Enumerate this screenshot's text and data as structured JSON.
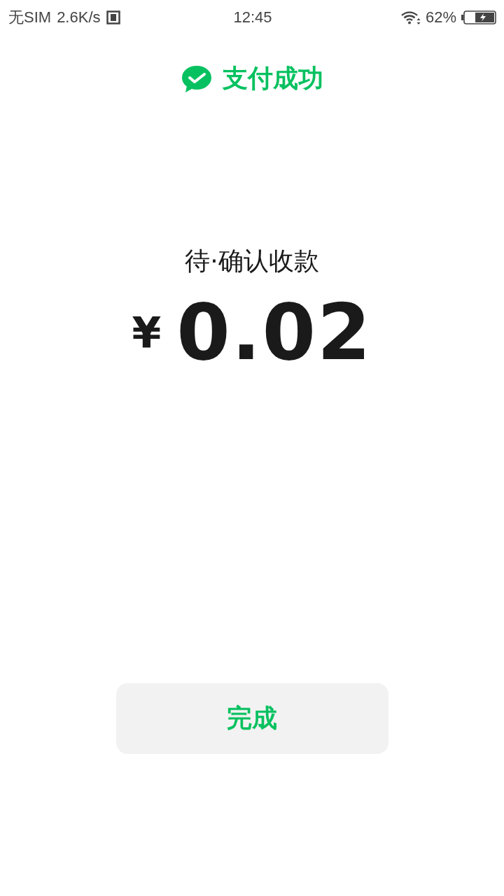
{
  "status_bar": {
    "carrier": "无SIM",
    "speed": "2.6K/s",
    "time": "12:45",
    "battery": "62%"
  },
  "header": {
    "title": "支付成功"
  },
  "payment": {
    "status": "待·确认收款",
    "currency": "¥",
    "amount": "0.02"
  },
  "buttons": [
    {
      "label": "完成"
    }
  ]
}
